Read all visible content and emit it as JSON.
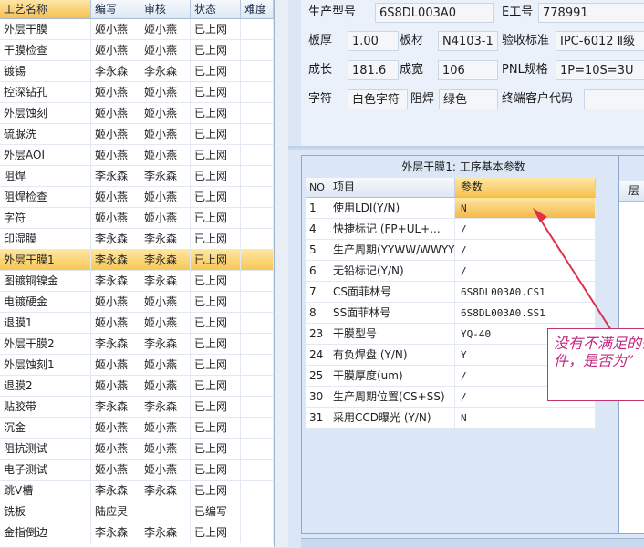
{
  "process_list": {
    "headers": [
      "工艺名称",
      "编写",
      "审核",
      "状态",
      "难度"
    ],
    "rows": [
      {
        "name": "外层干膜",
        "writer": "姬小燕",
        "reviewer": "姬小燕",
        "status": "已上网"
      },
      {
        "name": "干膜检查",
        "writer": "姬小燕",
        "reviewer": "姬小燕",
        "status": "已上网"
      },
      {
        "name": "镀锡",
        "writer": "李永森",
        "reviewer": "李永森",
        "status": "已上网"
      },
      {
        "name": "控深钻孔",
        "writer": "姬小燕",
        "reviewer": "姬小燕",
        "status": "已上网"
      },
      {
        "name": "外层蚀刻",
        "writer": "姬小燕",
        "reviewer": "姬小燕",
        "status": "已上网"
      },
      {
        "name": "硫脲洗",
        "writer": "姬小燕",
        "reviewer": "姬小燕",
        "status": "已上网"
      },
      {
        "name": "外层AOI",
        "writer": "姬小燕",
        "reviewer": "姬小燕",
        "status": "已上网"
      },
      {
        "name": "阻焊",
        "writer": "李永森",
        "reviewer": "李永森",
        "status": "已上网"
      },
      {
        "name": "阻焊检查",
        "writer": "姬小燕",
        "reviewer": "姬小燕",
        "status": "已上网"
      },
      {
        "name": "字符",
        "writer": "姬小燕",
        "reviewer": "姬小燕",
        "status": "已上网"
      },
      {
        "name": "印湿膜",
        "writer": "李永森",
        "reviewer": "李永森",
        "status": "已上网"
      },
      {
        "name": "外层干膜1",
        "writer": "李永森",
        "reviewer": "李永森",
        "status": "已上网"
      },
      {
        "name": "图镀铜镍金",
        "writer": "李永森",
        "reviewer": "李永森",
        "status": "已上网"
      },
      {
        "name": "电镀硬金",
        "writer": "姬小燕",
        "reviewer": "姬小燕",
        "status": "已上网"
      },
      {
        "name": "退膜1",
        "writer": "姬小燕",
        "reviewer": "姬小燕",
        "status": "已上网"
      },
      {
        "name": "外层干膜2",
        "writer": "李永森",
        "reviewer": "李永森",
        "status": "已上网"
      },
      {
        "name": "外层蚀刻1",
        "writer": "姬小燕",
        "reviewer": "姬小燕",
        "status": "已上网"
      },
      {
        "name": "退膜2",
        "writer": "姬小燕",
        "reviewer": "姬小燕",
        "status": "已上网"
      },
      {
        "name": "贴胶带",
        "writer": "李永森",
        "reviewer": "李永森",
        "status": "已上网"
      },
      {
        "name": "沉金",
        "writer": "姬小燕",
        "reviewer": "姬小燕",
        "status": "已上网"
      },
      {
        "name": "阻抗测试",
        "writer": "姬小燕",
        "reviewer": "姬小燕",
        "status": "已上网"
      },
      {
        "name": "电子测试",
        "writer": "姬小燕",
        "reviewer": "姬小燕",
        "status": "已上网"
      },
      {
        "name": "跳V槽",
        "writer": "李永森",
        "reviewer": "李永森",
        "status": "已上网"
      },
      {
        "name": "铣板",
        "writer": "陆应灵",
        "reviewer": "",
        "status": "已编写"
      },
      {
        "name": "金指倒边",
        "writer": "李永森",
        "reviewer": "李永森",
        "status": "已上网"
      }
    ]
  },
  "info": {
    "model_label": "生产型号",
    "model_value": "6S8DL003A0",
    "e_label": "E工号",
    "e_value": "778991",
    "thickness_label": "板厚",
    "thickness_value": "1.00",
    "material_label": "板材",
    "material_value": "N4103-1",
    "standard_label": "验收标准",
    "standard_value": "IPC-6012 Ⅱ级",
    "length_label": "成长",
    "length_value": "181.6",
    "width_label": "成宽",
    "width_value": "106",
    "pnl_label": "PNL规格",
    "pnl_value": "1P=10S=3U",
    "char_label": "字符",
    "char_value": "白色字符",
    "mask_label": "阻焊",
    "mask_value": "绿色",
    "customer_label": "终端客户代码",
    "customer_value": ""
  },
  "params": {
    "title": "外层干膜1: 工序基本参数",
    "headers": [
      "NO",
      "项目",
      "参数"
    ],
    "rows": [
      {
        "no": "1",
        "item": "使用LDI(Y/N)",
        "value": "N"
      },
      {
        "no": "4",
        "item": "快捷标记 (FP+UL+...",
        "value": "/"
      },
      {
        "no": "5",
        "item": "生产周期(YYWW/WWYY)",
        "value": "/"
      },
      {
        "no": "6",
        "item": "无铅标记(Y/N)",
        "value": "/"
      },
      {
        "no": "7",
        "item": "CS面菲林号",
        "value": "6S8DL003A0.CS1"
      },
      {
        "no": "8",
        "item": "SS面菲林号",
        "value": "6S8DL003A0.SS1"
      },
      {
        "no": "23",
        "item": "干膜型号",
        "value": "YQ-40"
      },
      {
        "no": "24",
        "item": "有负焊盘 (Y/N)",
        "value": "Y"
      },
      {
        "no": "25",
        "item": "干膜厚度(um)",
        "value": "/"
      },
      {
        "no": "30",
        "item": "生产周期位置(CS+SS)",
        "value": "/"
      },
      {
        "no": "31",
        "item": "采用CCD曝光 (Y/N)",
        "value": "N"
      }
    ]
  },
  "side_grid": {
    "header": "层"
  },
  "annotation": {
    "text": "没有不满足的条件，是否为”",
    "color": "#c0267d",
    "arrow_color": "#e0304a"
  }
}
